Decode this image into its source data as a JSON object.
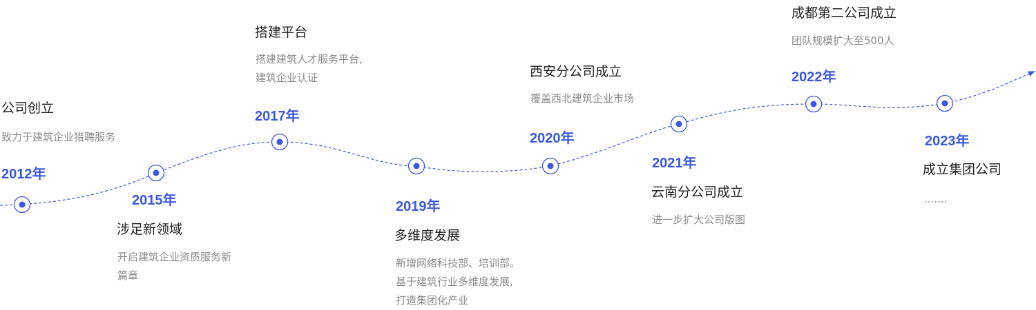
{
  "colors": {
    "accent": "#3a57e0",
    "title": "#222222",
    "desc": "#8a8a8a"
  },
  "timeline": {
    "milestones": [
      {
        "year": "2012年",
        "title": "公司创立",
        "desc": [
          "致力于建筑企业猎聘服务"
        ]
      },
      {
        "year": "2015年",
        "title": "涉足新领域",
        "desc": [
          "开启建筑企业资质服务新",
          "篇章"
        ]
      },
      {
        "year": "2017年",
        "title": "搭建平台",
        "desc": [
          "搭建建筑人才服务平台,",
          "建筑企业认证"
        ]
      },
      {
        "year": "2019年",
        "title": "多维度发展",
        "desc": [
          "新增网络科技部、培训部。",
          "基于建筑行业多维度发展,",
          "打造集团化产业"
        ]
      },
      {
        "year": "2020年",
        "title": "西安分公司成立",
        "desc": [
          "覆盖西北建筑企业市场"
        ]
      },
      {
        "year": "2021年",
        "title": "云南分公司成立",
        "desc": [
          "进一步扩大公司版图"
        ]
      },
      {
        "year": "2022年",
        "title": "成都第二公司成立",
        "desc": [
          "团队规模扩大至500人"
        ]
      },
      {
        "year": "2023年",
        "title": "成立集团公司",
        "desc": [
          "......."
        ]
      }
    ]
  }
}
